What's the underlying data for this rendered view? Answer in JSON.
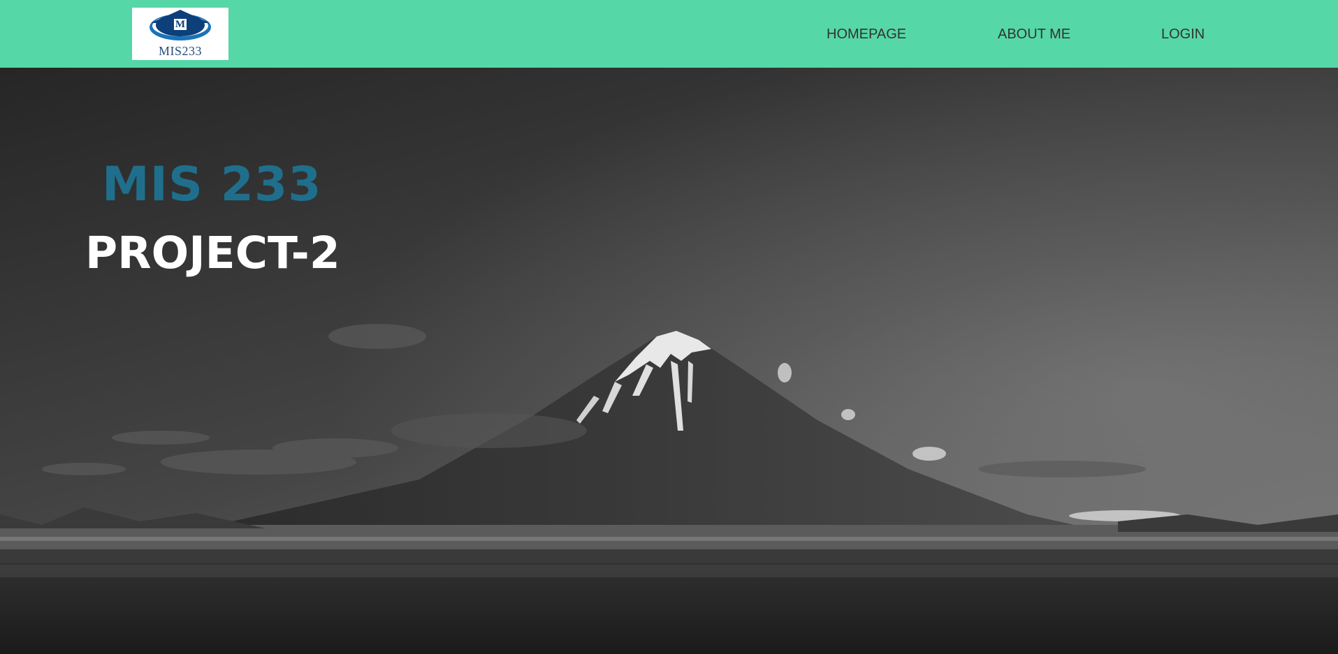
{
  "header": {
    "logo": {
      "letter": "M",
      "text": "MIS233"
    },
    "nav": [
      {
        "label": "HOMEPAGE"
      },
      {
        "label": "ABOUT ME"
      },
      {
        "label": "LOGIN"
      }
    ]
  },
  "hero": {
    "kicker": "MIS 233",
    "title": "PROJECT-2",
    "image": "mountain-lake-landscape"
  },
  "colors": {
    "navbar": "#55d7a8",
    "nav_text": "#333333",
    "kicker": "#1f6f8c",
    "title": "#ffffff"
  }
}
